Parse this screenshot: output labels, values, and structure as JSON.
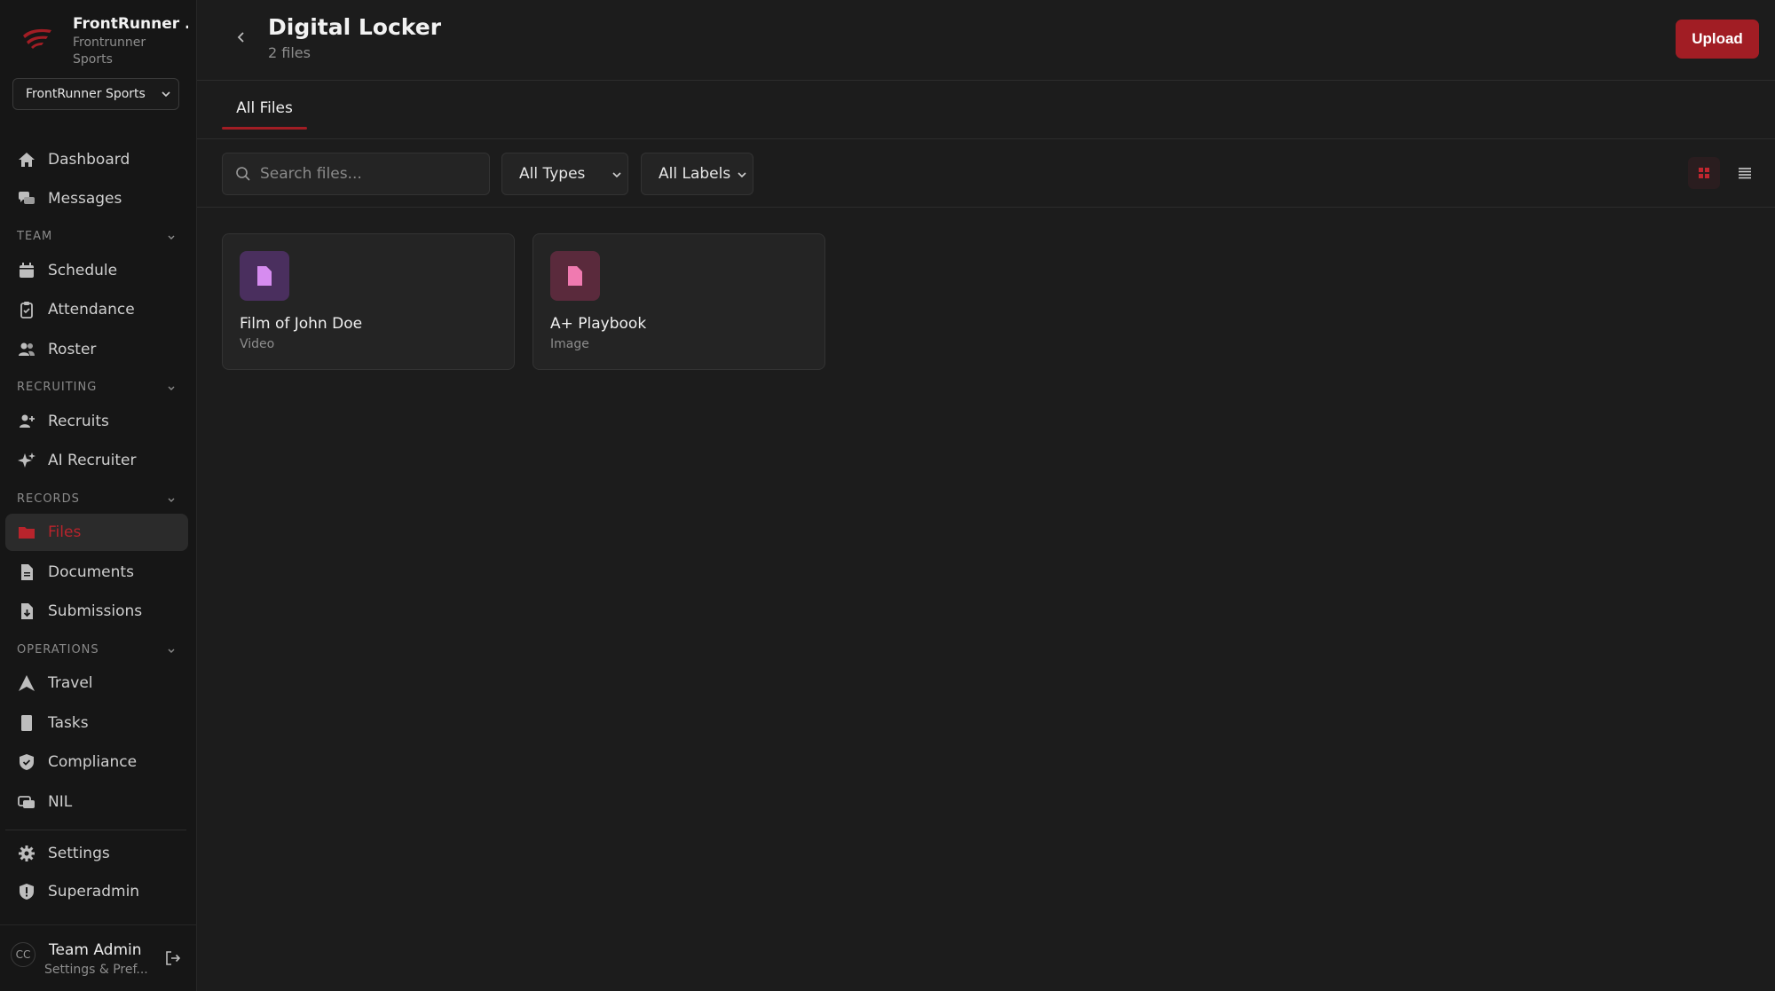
{
  "brand": {
    "name": "FrontRunner ...",
    "subtitle": "Frontrunner Sports",
    "org_selected": "FrontRunner Sports"
  },
  "nav": {
    "dashboard": "Dashboard",
    "messages": "Messages",
    "section_team": "TEAM",
    "schedule": "Schedule",
    "attendance": "Attendance",
    "roster": "Roster",
    "section_recruiting": "RECRUITING",
    "recruits": "Recruits",
    "ai_recruiter": "AI Recruiter",
    "section_records": "RECORDS",
    "files": "Files",
    "documents": "Documents",
    "submissions": "Submissions",
    "section_operations": "OPERATIONS",
    "travel": "Travel",
    "tasks": "Tasks",
    "compliance": "Compliance",
    "nil": "NIL",
    "settings": "Settings",
    "superadmin": "Superadmin"
  },
  "user": {
    "initials": "CC",
    "name": "Team Admin",
    "subtitle": "Settings & Pref..."
  },
  "header": {
    "title": "Digital Locker",
    "subtitle": "2 files",
    "upload_label": "Upload"
  },
  "tabs": [
    {
      "label": "All Files",
      "active": true
    }
  ],
  "toolbar": {
    "search_placeholder": "Search files...",
    "type_filter": "All Types",
    "label_filter": "All Labels"
  },
  "files": [
    {
      "name": "Film of John Doe",
      "type": "Video",
      "icon": "file-icon",
      "thumb_bg": "#4a2f5e",
      "icon_color": "#d68cf0"
    },
    {
      "name": "A+ Playbook",
      "type": "Image",
      "icon": "file-icon",
      "thumb_bg": "#5a2a3c",
      "icon_color": "#f07ab0"
    }
  ],
  "colors": {
    "accent": "#a11d24",
    "active_text": "#b8242c",
    "background": "#1c1c1c",
    "sidebar": "#161616"
  }
}
